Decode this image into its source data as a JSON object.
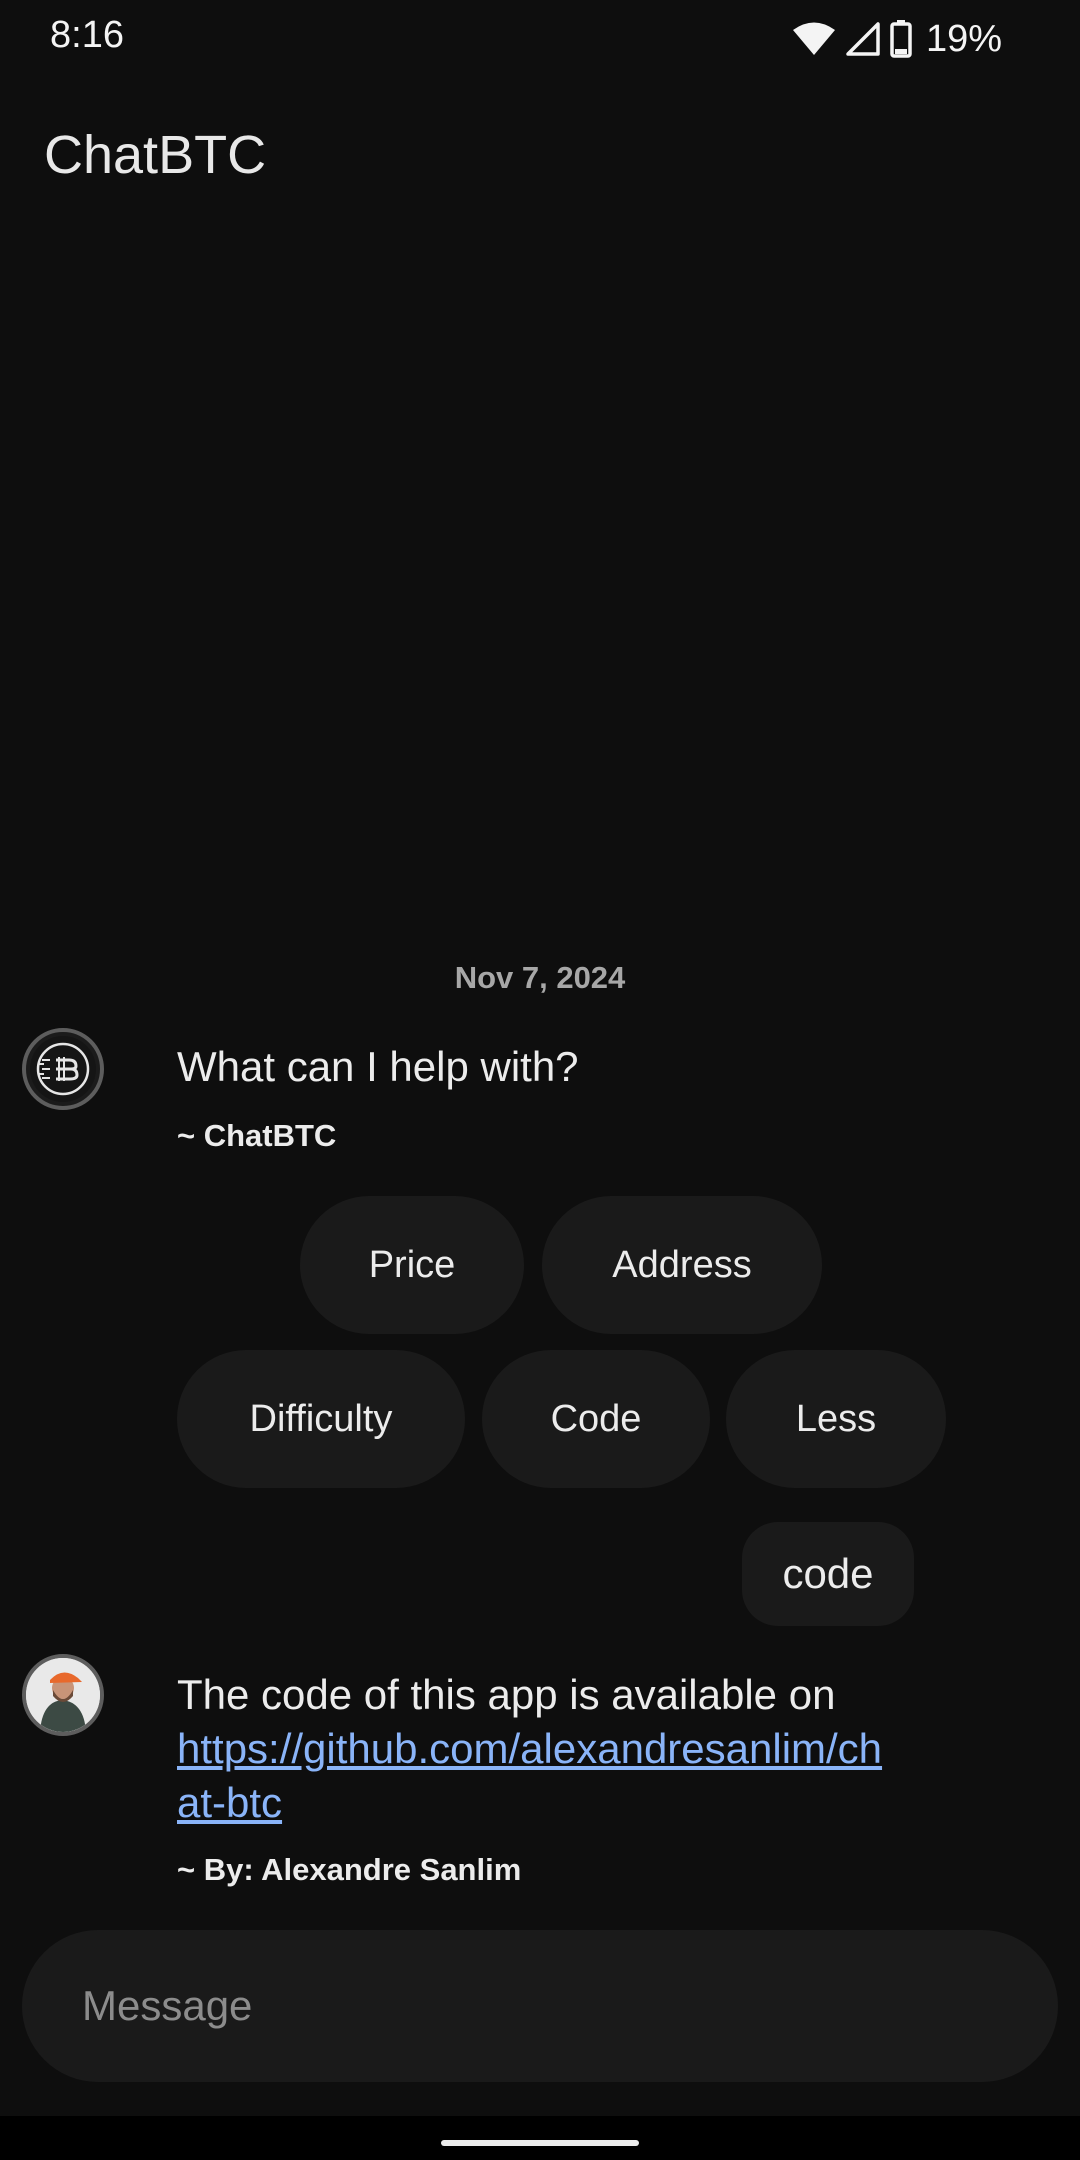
{
  "status_bar": {
    "time": "8:16",
    "battery_percent": "19%",
    "icons": [
      "wifi-icon",
      "cellular-signal-icon",
      "battery-icon"
    ]
  },
  "app": {
    "title": "ChatBTC"
  },
  "chat": {
    "date_separator": "Nov 7, 2024",
    "bot_message": {
      "text": "What can I help with?",
      "signature": "~ ChatBTC",
      "avatar": "bitcoin-logo-icon"
    },
    "suggestion_chips": [
      {
        "label": "Price"
      },
      {
        "label": "Address"
      },
      {
        "label": "Difficulty"
      },
      {
        "label": "Code"
      },
      {
        "label": "Less"
      }
    ],
    "user_message": {
      "text": "code"
    },
    "reply_message": {
      "text": "The code of this app is available on",
      "link": "https://github.com/alexandresanlim/chat-btc",
      "signature": "~ By: Alexandre Sanlim",
      "avatar": "author-photo"
    }
  },
  "composer": {
    "placeholder": "Message",
    "value": ""
  },
  "colors": {
    "background": "#0e0e0e",
    "surface": "#1a1a1a",
    "text": "#ececec",
    "muted_text": "#a7a7a7",
    "link": "#8ab4f8"
  }
}
